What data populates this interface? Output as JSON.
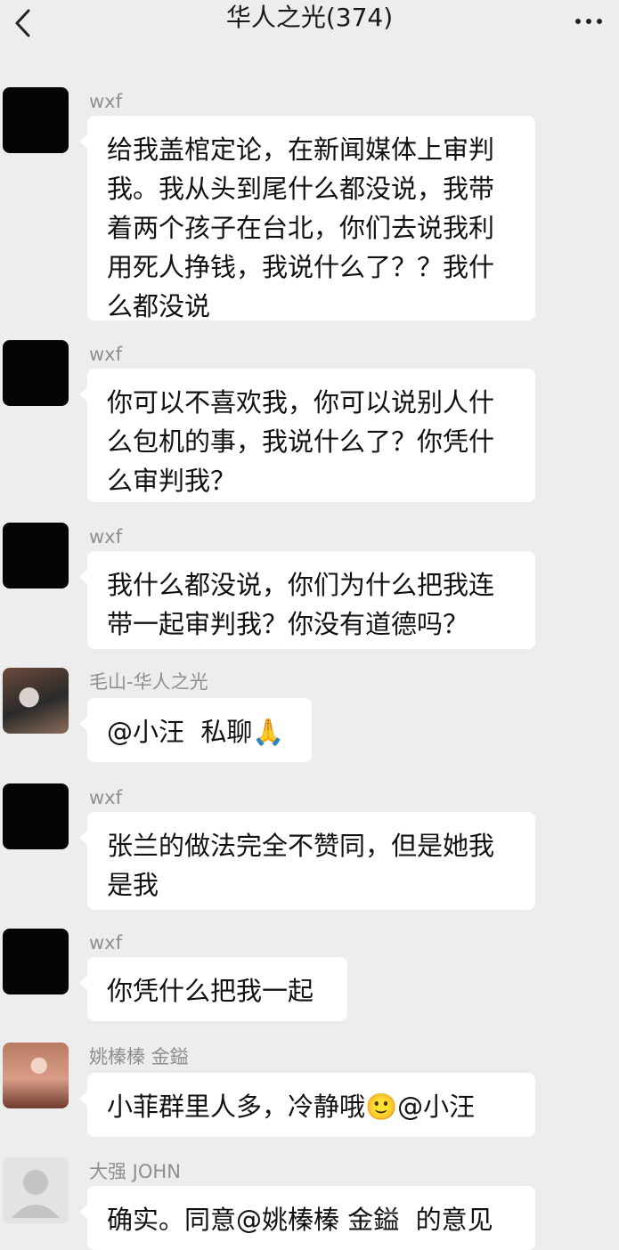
{
  "header": {
    "title": "华人之光(374)"
  },
  "messages": [
    {
      "sender": "wxf",
      "avatar": "black",
      "text": "给我盖棺定论，在新闻媒体上审判\n我。我从头到尾什么都没说，我带\n着两个孩子在台北，你们去说我利\n用死人挣钱，我说什么了？？我什\n么都没说"
    },
    {
      "sender": "wxf",
      "avatar": "black",
      "text": "你可以不喜欢我，你可以说别人什\n么包机的事，我说什么了？你凭什\n么审判我？"
    },
    {
      "sender": "wxf",
      "avatar": "black",
      "text": "我什么都没说，你们为什么把我连\n带一起审判我？你没有道德吗？"
    },
    {
      "sender": "毛山-华人之光",
      "avatar": "photo1",
      "text": "@小汪  私聊🙏"
    },
    {
      "sender": "wxf",
      "avatar": "black",
      "text": "张兰的做法完全不赞同，但是她我\n是我"
    },
    {
      "sender": "wxf",
      "avatar": "black",
      "text": "你凭什么把我一起"
    },
    {
      "sender": "姚榛榛 金鎰",
      "avatar": "photo2",
      "text": "小菲群里人多，冷静哦🙂@小汪"
    },
    {
      "sender": "大强 JOHN",
      "avatar": "default",
      "text": "确实。同意@姚榛榛 金鎰  的意见"
    }
  ]
}
